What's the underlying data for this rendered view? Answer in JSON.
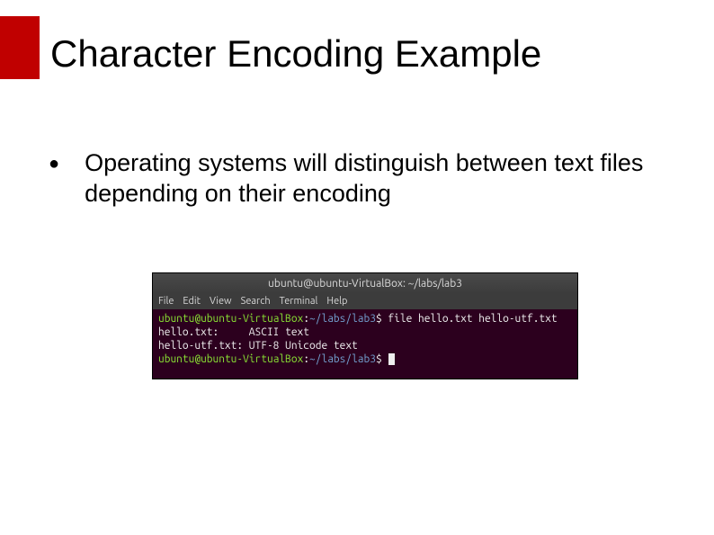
{
  "title": "Character Encoding Example",
  "bullet": "Operating systems will distinguish between text files depending on their encoding",
  "terminal": {
    "title": "ubuntu@ubuntu-VirtualBox: ~/labs/lab3",
    "menu": [
      "File",
      "Edit",
      "View",
      "Search",
      "Terminal",
      "Help"
    ],
    "prompt": {
      "user": "ubuntu",
      "at": "@",
      "host": "ubuntu-VirtualBox",
      "colon": ":",
      "path": "~/labs/lab3",
      "dollar": "$"
    },
    "command1": " file hello.txt hello-utf.txt",
    "output1": "hello.txt:     ASCII text",
    "output2": "hello-utf.txt: UTF-8 Unicode text"
  }
}
